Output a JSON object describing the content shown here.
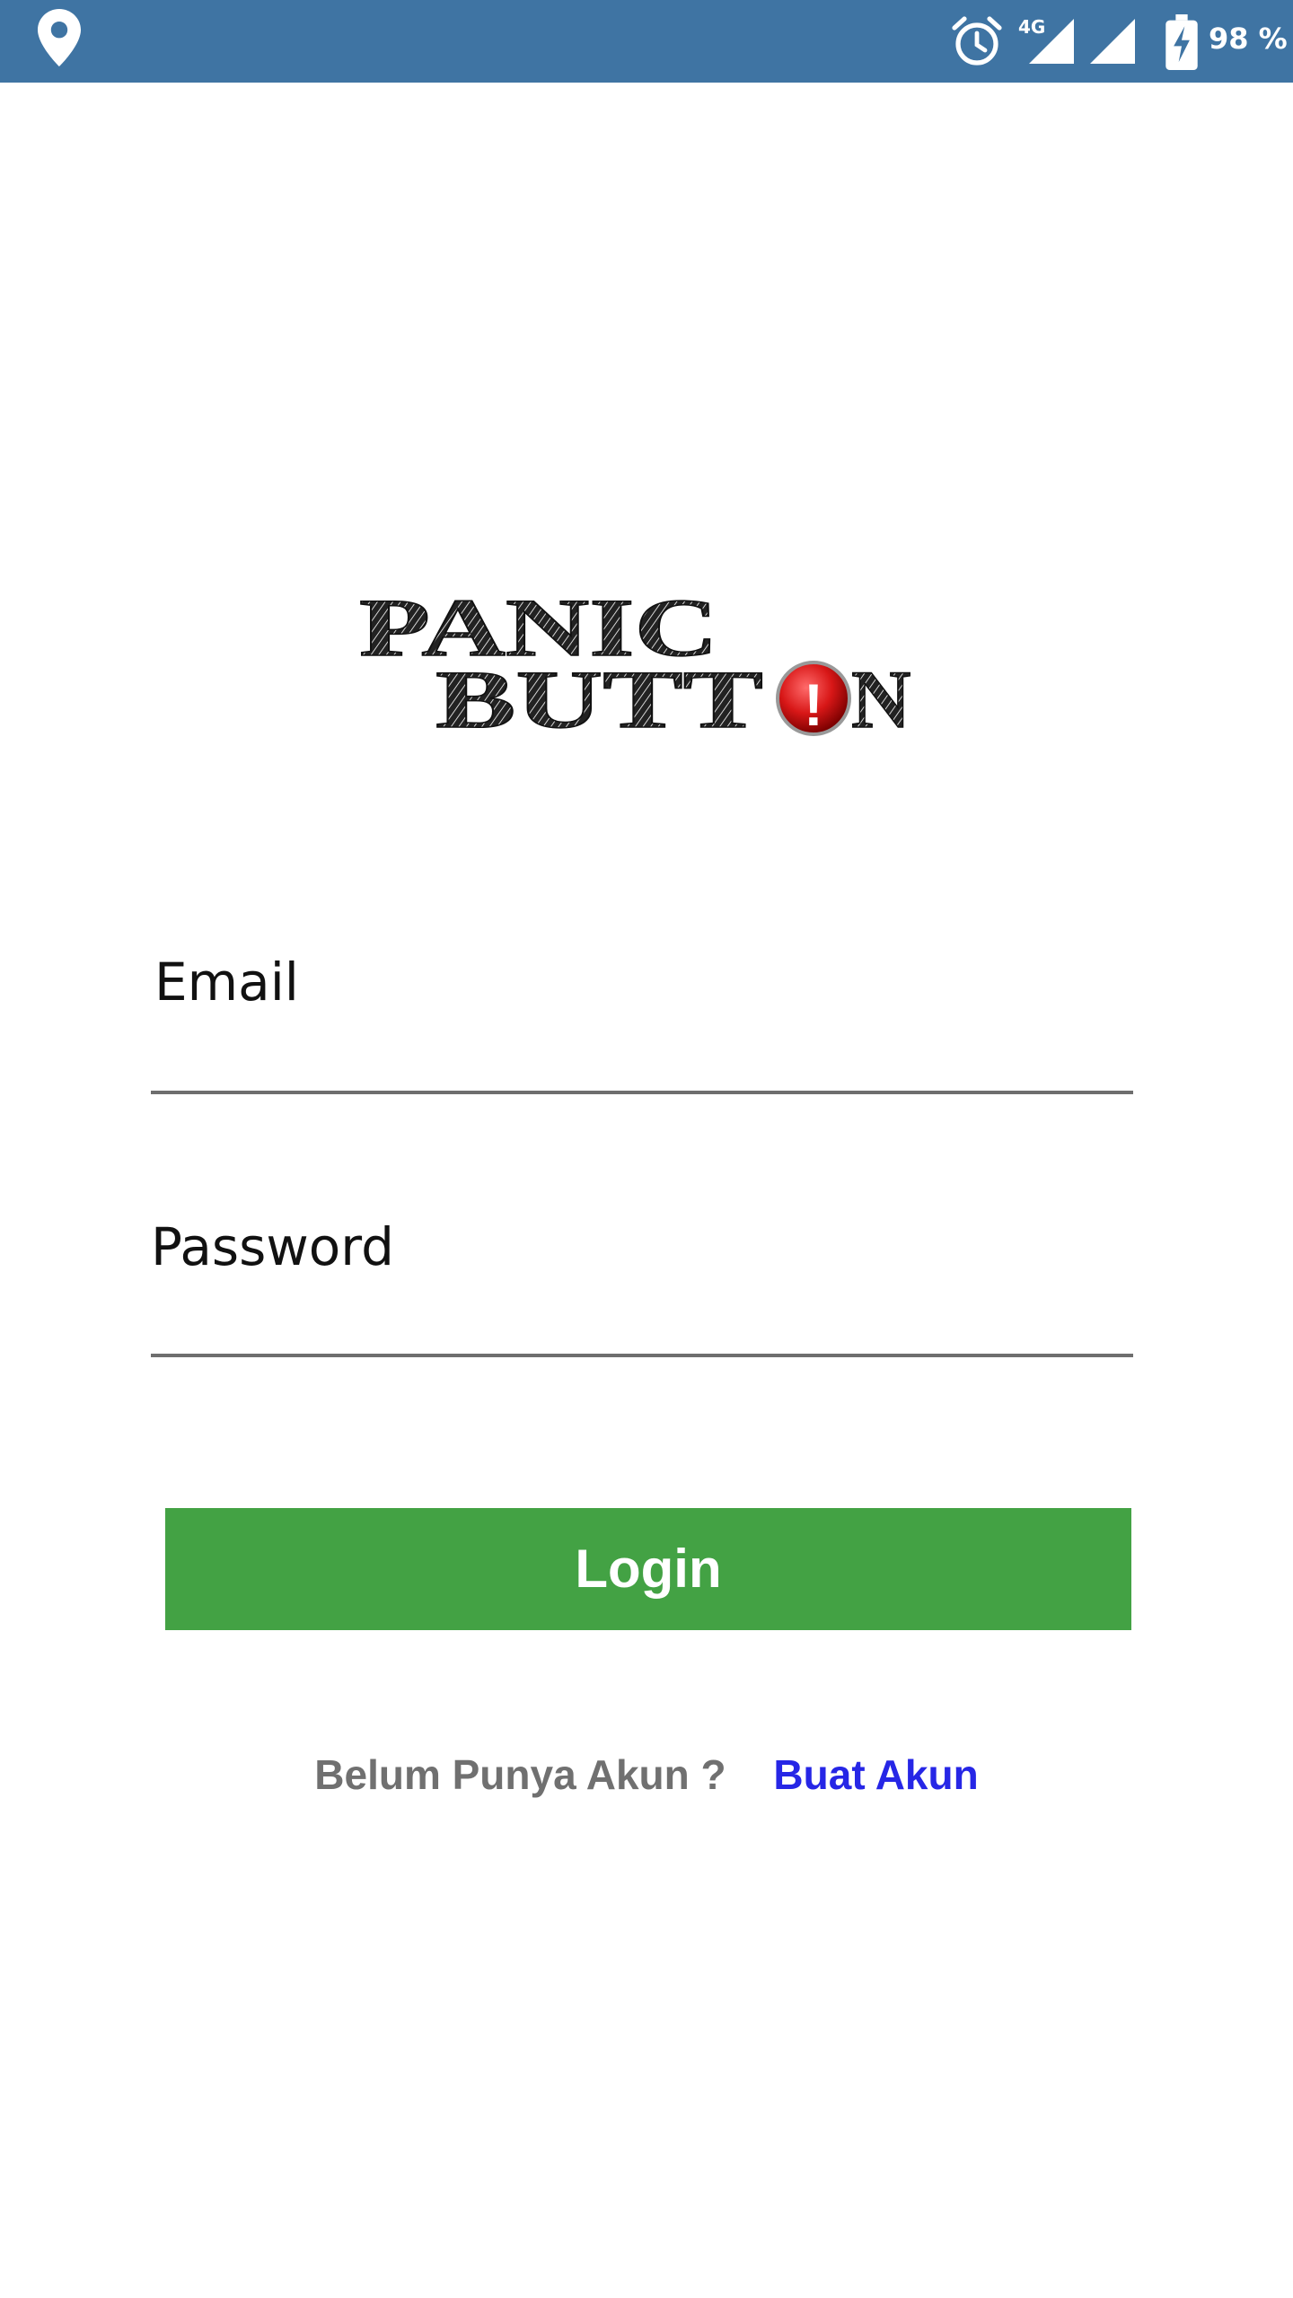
{
  "status_bar": {
    "network_label": "4G",
    "battery_text": "98 %",
    "background_color": "#3f74a3",
    "icons": [
      "location-pin-icon",
      "alarm-clock-icon",
      "signal-icon",
      "signal-icon",
      "battery-charging-icon"
    ]
  },
  "logo": {
    "line1": "PANIC",
    "line2_prefix": "BUTT",
    "line2_suffix": "N",
    "badge": "!"
  },
  "form": {
    "email_label": "Email",
    "email_value": "",
    "password_label": "Password",
    "password_value": ""
  },
  "login_button": {
    "label": "Login",
    "color": "#43a244"
  },
  "signup": {
    "prompt": "Belum Punya Akun ?",
    "link_label": "Buat Akun",
    "link_color": "#2626e6"
  }
}
